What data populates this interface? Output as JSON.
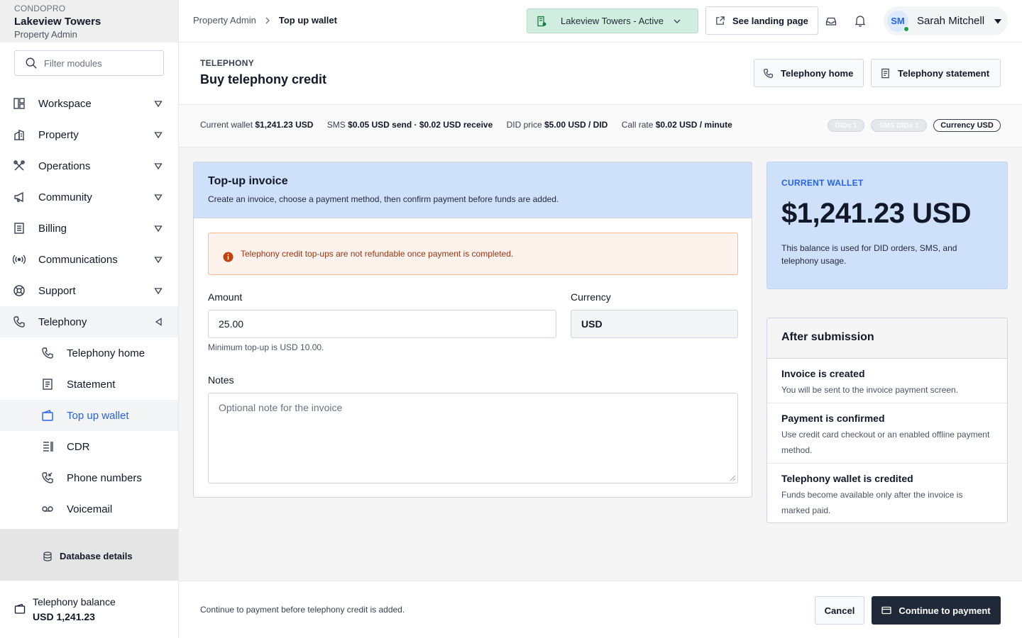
{
  "brand": {
    "org": "CONDOPRO",
    "property": "Lakeview Towers",
    "role": "Property Admin"
  },
  "sidebar": {
    "filter_placeholder": "Filter modules",
    "items": [
      {
        "label": "Workspace",
        "icon": "workspace-icon"
      },
      {
        "label": "Property",
        "icon": "building-icon"
      },
      {
        "label": "Operations",
        "icon": "tools-icon"
      },
      {
        "label": "Community",
        "icon": "megaphone-icon"
      },
      {
        "label": "Billing",
        "icon": "receipt-icon"
      },
      {
        "label": "Communications",
        "icon": "broadcast-icon"
      },
      {
        "label": "Support",
        "icon": "lifebuoy-icon"
      },
      {
        "label": "Telephony",
        "icon": "phone-icon"
      }
    ],
    "telephony_sub": [
      {
        "label": "Telephony home",
        "icon": "phone-icon"
      },
      {
        "label": "Statement",
        "icon": "document-icon"
      },
      {
        "label": "Top up wallet",
        "icon": "wallet-icon",
        "active": true
      },
      {
        "label": "CDR",
        "icon": "list-icon"
      },
      {
        "label": "Phone numbers",
        "icon": "phone-incoming-icon"
      },
      {
        "label": "Voicemail",
        "icon": "voicemail-icon"
      }
    ],
    "db_details": "Database details",
    "balance_label": "Telephony balance",
    "balance_value": "USD 1,241.23"
  },
  "topbar": {
    "breadcrumb": [
      "Property Admin",
      "Top up wallet"
    ],
    "property_select": "Lakeview Towers - Active",
    "landing_button": "See landing page",
    "user": {
      "initials": "SM",
      "name": "Sarah Mitchell"
    }
  },
  "page": {
    "eyebrow": "TELEPHONY",
    "title": "Buy telephony credit",
    "btn_home": "Telephony home",
    "btn_statement": "Telephony statement"
  },
  "stats": {
    "wallet_label": "Current wallet",
    "wallet_value": "$1,241.23 USD",
    "sms_label": "SMS",
    "sms_value": "$0.05 USD send · $0.02 USD receive",
    "did_label": "DID price",
    "did_value": "$5.00 USD / DID",
    "call_label": "Call rate",
    "call_value": "$0.02 USD / minute",
    "pill_dids": "DIDs 1",
    "pill_sms_dids": "SMS DIDs 1",
    "pill_currency_label": "Currency",
    "pill_currency_value": "USD"
  },
  "invoice": {
    "title": "Top-up invoice",
    "subtitle": "Create an invoice, choose a payment method, then confirm payment before funds are added.",
    "warning": "Telephony credit top-ups are not refundable once payment is completed.",
    "amount_label": "Amount",
    "amount_value": "25.00",
    "amount_hint": "Minimum top-up is USD 10.00.",
    "currency_label": "Currency",
    "currency_value": "USD",
    "notes_label": "Notes",
    "notes_placeholder": "Optional note for the invoice"
  },
  "wallet": {
    "caption": "CURRENT WALLET",
    "amount": "$1,241.23 USD",
    "description": "This balance is used for DID orders, SMS, and telephony usage."
  },
  "after": {
    "title": "After submission",
    "steps": [
      {
        "title": "Invoice is created",
        "desc": "You will be sent to the invoice payment screen."
      },
      {
        "title": "Payment is confirmed",
        "desc": "Use credit card checkout or an enabled offline payment method."
      },
      {
        "title": "Telephony wallet is credited",
        "desc": "Funds become available only after the invoice is marked paid."
      }
    ]
  },
  "footer": {
    "note": "Continue to payment before telephony credit is added.",
    "cancel": "Cancel",
    "continue": "Continue to payment"
  },
  "colors": {
    "accent": "#2563eb",
    "primary_button": "#1f2937",
    "info_panel": "#cfe0fb",
    "warning_bg": "#fef3ec"
  }
}
